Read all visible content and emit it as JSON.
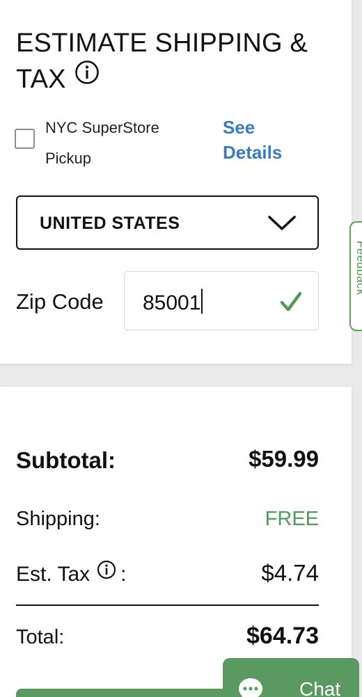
{
  "estimate": {
    "title": "ESTIMATE SHIPPING & TAX",
    "pickup_label_line1": "NYC SuperStore",
    "pickup_label_line2": "Pickup",
    "pickup_checked": false,
    "see_details_line1": "See",
    "see_details_line2": "Details",
    "country_selected": "UNITED STATES",
    "zip_label": "Zip Code",
    "zip_value": "85001"
  },
  "feedback": {
    "label": "Feedback"
  },
  "totals": {
    "subtotal_label": "Subtotal:",
    "subtotal_value": "$59.99",
    "shipping_label": "Shipping:",
    "shipping_value": "FREE",
    "tax_label": "Est. Tax",
    "tax_colon": ":",
    "tax_value": "$4.74",
    "total_label": "Total:",
    "total_value": "$64.73"
  },
  "chat": {
    "label": "Chat"
  },
  "colors": {
    "link": "#3a7bbf",
    "success_green": "#4d9a5a",
    "button_green": "#5a9a62",
    "card_bg": "#ffffff",
    "page_bg": "#e9e9e9"
  },
  "icons": {
    "title_info": "info-icon",
    "select_chevron": "chevron-down-icon",
    "zip_valid": "check-icon",
    "tax_info": "info-icon",
    "chat": "chat-bubble-icon"
  }
}
